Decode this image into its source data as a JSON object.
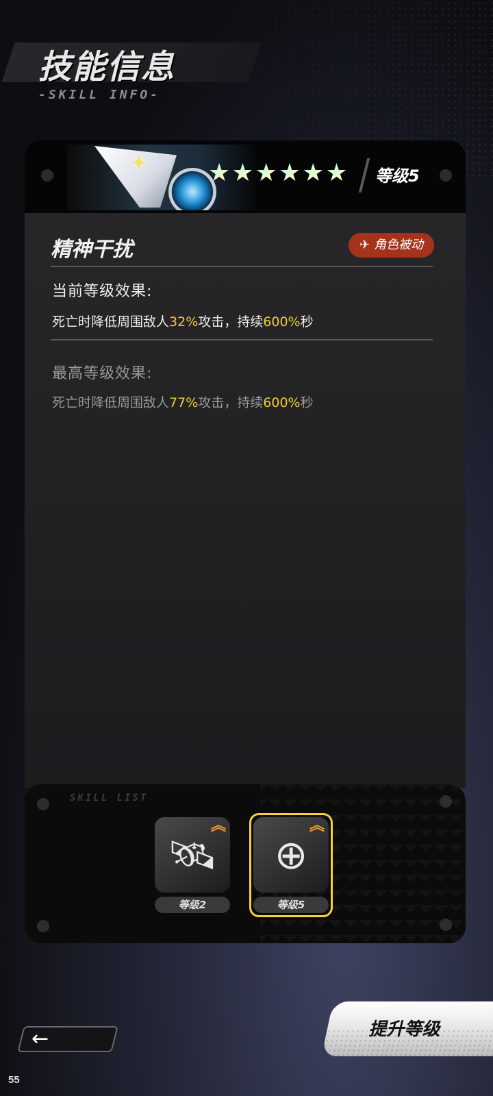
{
  "header": {
    "title": "技能信息",
    "subtitle": "-SKILL INFO-"
  },
  "skill": {
    "stars": [
      "★",
      "★",
      "★",
      "★",
      "★",
      "★"
    ],
    "level_label": "等级5",
    "name": "精神干扰",
    "badge": "角色被动",
    "current_label": "当前等级效果:",
    "current_effect": {
      "prefix": "死亡时降低周围敌人",
      "value1": "32%",
      "mid": "攻击，持续",
      "value2": "600%",
      "suffix": "秒"
    },
    "max_label": "最高等级效果:",
    "max_effect": {
      "prefix": "死亡时降低周围敌人",
      "value1": "77%",
      "mid": "攻击，持续",
      "value2": "600%",
      "suffix": "秒"
    }
  },
  "skill_list": {
    "title": "SKILL LIST",
    "items": [
      {
        "level": "等级2",
        "icon": "satellite-icon",
        "selected": false
      },
      {
        "level": "等级5",
        "icon": "target-icon",
        "selected": true
      }
    ]
  },
  "footer": {
    "upgrade_label": "提升等级",
    "page_number": "55"
  },
  "colors": {
    "highlight": "#f5cb33",
    "badge": "#a5331b",
    "selected_border": "#f4d23a",
    "upgrade_arrow": "#f29b2a"
  }
}
